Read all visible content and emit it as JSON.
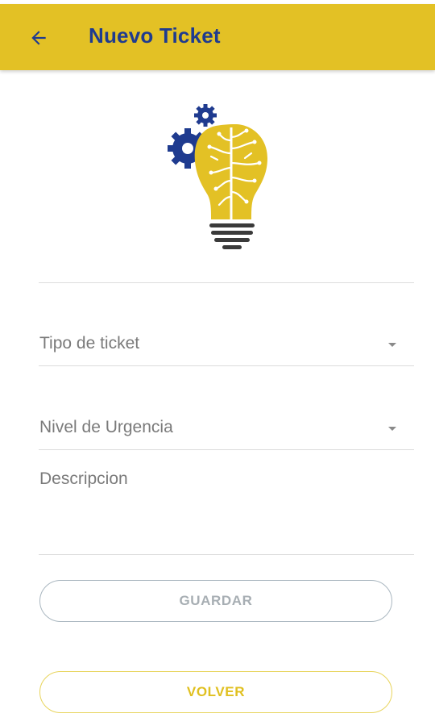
{
  "header": {
    "title": "Nuevo Ticket",
    "background_color": "#e3c125",
    "title_color": "#1f3b8f",
    "back_icon": "arrow-left-icon"
  },
  "logo": {
    "icon": "lightbulb-brain-gears-icon",
    "gear_color": "#1f3b8f",
    "bulb_color": "#e3c125"
  },
  "form": {
    "ticket_type": {
      "label": "Tipo de ticket",
      "icon": "dropdown-caret-icon"
    },
    "urgency_level": {
      "label": "Nivel de Urgencia",
      "icon": "dropdown-caret-icon"
    },
    "description": {
      "placeholder": "Descripcion",
      "value": ""
    }
  },
  "actions": {
    "save_label": "GUARDAR",
    "back_label": "VOLVER",
    "save_border_color": "#aab7c0",
    "back_color": "#e0c020"
  }
}
